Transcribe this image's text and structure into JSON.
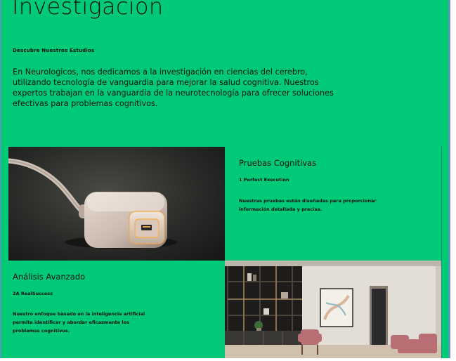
{
  "hero": {
    "title": "Investigacion",
    "subtitle": "Descubre Nuestros Estudios",
    "intro": "En Neurologicos, nos dedicamos a la investigación en ciencias del cerebro, utilizando tecnología de vanguardia para mejorar la salud cognitiva. Nuestros expertos trabajan en la vanguardia de la neurotecnología para ofrecer soluciones efectivas para problemas cognitivos."
  },
  "cards": [
    {
      "title": "Pruebas Cognitivas",
      "tag": "1 Perfect Execution",
      "text": "Nuestras pruebas están diseñadas para proporcionar información detallada y precisa."
    },
    {
      "title": "Análisis Avanzado",
      "tag": "2A RealSuccess",
      "text": "Nuestro enfoque basado en la inteligencia artificial permite identificar y abordar eficazmente los problemas cognitivos."
    }
  ],
  "colors": {
    "accent_green": "#00c978",
    "edge_purple": "#8a78e6"
  }
}
